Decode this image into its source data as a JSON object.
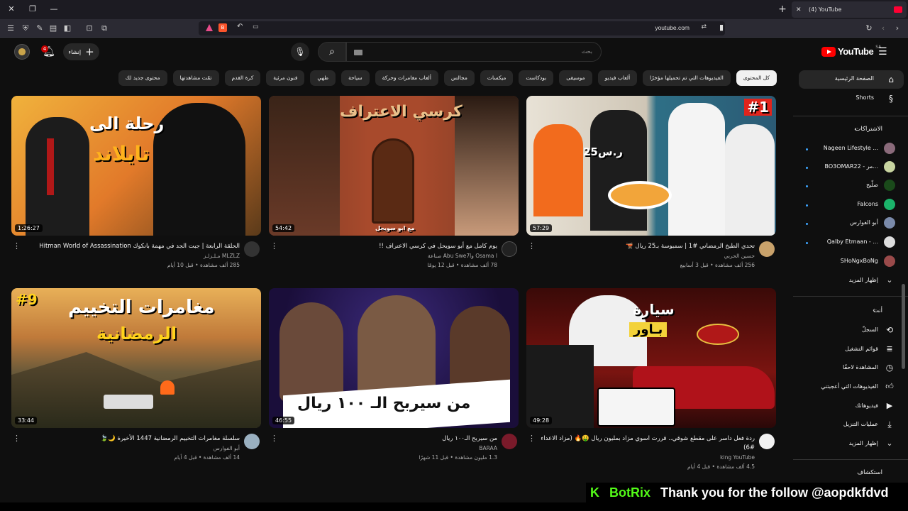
{
  "browser": {
    "tab_title": "(4) YouTube",
    "url": "youtube.com"
  },
  "header": {
    "create_label": "إنشاء",
    "notif_count": "4",
    "search_placeholder": "بحث",
    "logo_text": "YouTube",
    "logo_region": "SA"
  },
  "chips": [
    "كل المحتوى",
    "الفيديوهات التي تم تحميلها مؤخرًا",
    "ألعاب فيديو",
    "موسيقى",
    "بودكاست",
    "ميكسات",
    "مجالس",
    "ألعاب مغامرات وحركة",
    "سياحة",
    "طهي",
    "فنون مرئية",
    "كرة القدم",
    "تمّت مشاهدتها",
    "محتوى جديد لك"
  ],
  "videos": [
    {
      "title": "تحدي الطبخ الرمضاني #1 | سمبوسة بـ25 ريال 🫕",
      "channel": "حسين الحربي",
      "stats": "256 ألف مشاهدة • قبل 3 أسابيع",
      "duration": "57:29",
      "thumb_text": "#1",
      "thumb_text2": "25ر.س"
    },
    {
      "title": "يوم كامل مع أبو سويحل في كرسي الاعتراف !!",
      "channel": "Osama l وAbu Swe7l صناعة",
      "stats": "78 ألف مشاهدة • قبل 12 يومًا",
      "duration": "54:42",
      "thumb_text": "كرسي الاعتراف",
      "thumb_text2": "مع ابو سويحل"
    },
    {
      "title": "الحلقة الرابعة | جبت الجد في مهمة بانكوك Hitman World of Assassination",
      "channel": "MLZLZ مـلـزلـز",
      "stats": "285 ألف مشاهدة • قبل 10 أيام",
      "duration": "1:26:27",
      "thumb_text": "رحلة الى",
      "thumb_text2": "تايلاند"
    },
    {
      "title": "ردة فعل داسر على مقطع شوقي.. قررت اسوي مزاد بمليون ريال 🤑🔥 (مزاد الاعداء #6)",
      "channel": "king YouTube",
      "stats": "4.5 ألف مشاهدة • قبل 4 أيام",
      "duration": "49:28",
      "thumb_text": "سيارة",
      "thumb_text2": "بـاور"
    },
    {
      "title": "من سيربح الـ١٠٠ ريال",
      "channel": "BARAA",
      "stats": "1.3 مليون مشاهدة • قبل 11 شهرًا",
      "duration": "46:55",
      "thumb_text": "من سيربح الـ ١٠٠ ريال",
      "thumb_text2": ""
    },
    {
      "title": "سلسلة مغامرات التخييم الرمضانية 1447 الأخيرة 🌙🍃",
      "channel": "أبو الفوارس",
      "stats": "14 ألف مشاهدة • قبل 4 أيام",
      "duration": "33:44",
      "thumb_text": "مغامرات التخييم",
      "thumb_text2": "الرمضانية"
    }
  ],
  "sidebar": {
    "home": "الصفحة الرئيسية",
    "shorts": "Shorts",
    "subs_heading": "الاشتراكات",
    "subs": [
      "Nageen Lifestyle ...",
      "BO3OMAR22 - مر...",
      "صلّيح",
      "Falcons",
      "أبو الفوارس",
      "Qalby Etmaan - ...",
      "SHoNgxBoNg"
    ],
    "show_more": "إظهار المزيد",
    "you_heading": "أنت",
    "you_items": [
      "السجلّ",
      "قوائم التشغيل",
      "المشاهدة لاحقًا",
      "الفيديوهات التي أعجبتني",
      "فيديوهاتك",
      "عمليات التنزيل"
    ],
    "show_more_2": "إظهار المزيد",
    "explore_heading": "استكشاف"
  },
  "overlay": {
    "k": "K",
    "bot_name": "BotRix",
    "message": "Thank you for the follow @aopdkfdvd"
  }
}
